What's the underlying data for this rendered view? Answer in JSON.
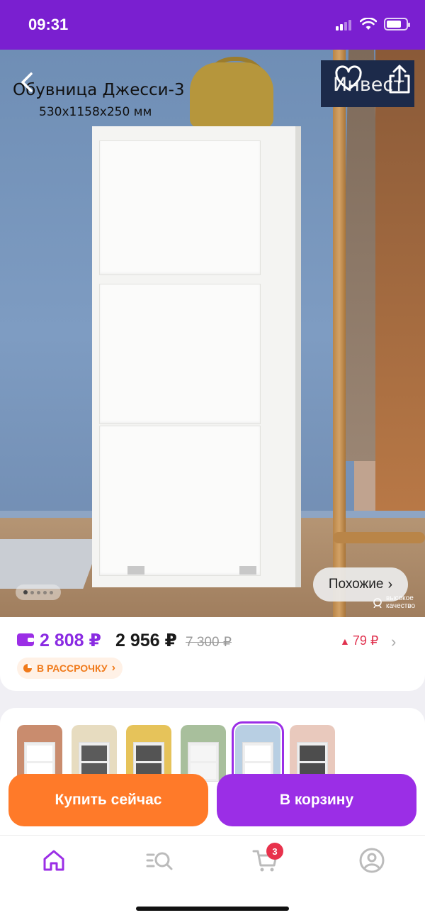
{
  "status_bar": {
    "time": "09:31",
    "battery_percent": 75
  },
  "product": {
    "title": "Обувница Джесси-3",
    "dimensions": "530х1158х250 мм",
    "brand": "Инвест",
    "gallery": {
      "total": 5,
      "active": 0
    },
    "similar_label": "Похожие",
    "quality_badge": [
      "высокое",
      "качество"
    ]
  },
  "price": {
    "wallet_price": "2 808 ₽",
    "price": "2 956 ₽",
    "old_price": "7 300 ₽",
    "price_change": "79 ₽",
    "installment_label": "В РАССРОЧКУ"
  },
  "variants": [
    {
      "name": "variant-1",
      "front": "#ffffff",
      "bg": "#c98c6e"
    },
    {
      "name": "variant-2",
      "front": "#5b5b5b",
      "bg": "#e7dcc0"
    },
    {
      "name": "variant-3",
      "front": "#545454",
      "bg": "#e6c35a"
    },
    {
      "name": "variant-4",
      "front": "#f5f5f5",
      "bg": "#a8bf9c"
    },
    {
      "name": "variant-5",
      "front": "#ffffff",
      "bg": "#b8cfe3",
      "selected": true
    },
    {
      "name": "variant-6",
      "front": "#4d4d4d",
      "bg": "#e9c9bd"
    }
  ],
  "actions": {
    "buy_now": "Купить сейчас",
    "add_to_cart": "В корзину"
  },
  "tabbar": {
    "items": [
      "home",
      "catalog",
      "cart",
      "profile"
    ],
    "active": "home",
    "cart_count": "3"
  },
  "colors": {
    "accent": "#9b2ee6",
    "orange": "#ff7a29",
    "status_bar": "#7a1fd0",
    "danger": "#e0314e"
  }
}
